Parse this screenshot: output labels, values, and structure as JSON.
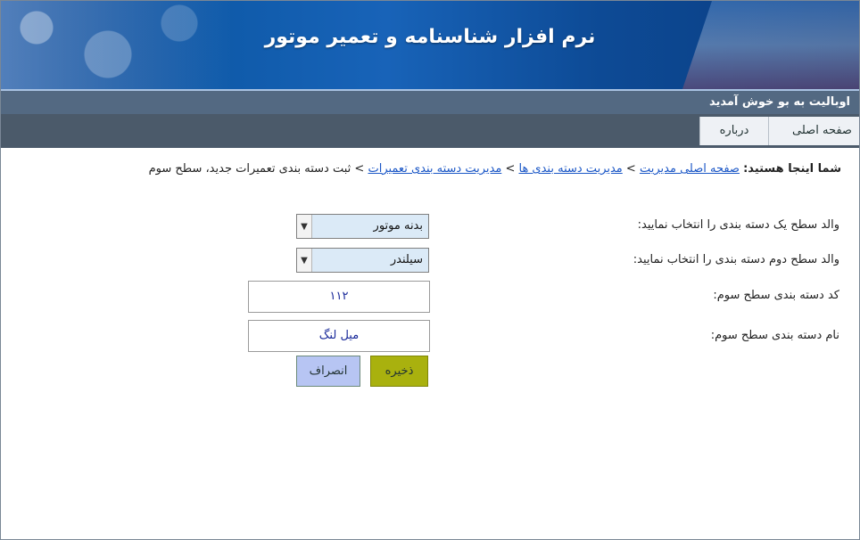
{
  "header": {
    "title": "نرم افزار شناسنامه و تعمیر موتور"
  },
  "welcome": {
    "text": "اوبالیت به بو خوش آمدید"
  },
  "menu": {
    "items": [
      "صفحه اصلی",
      "درباره"
    ]
  },
  "breadcrumb": {
    "lead": "شما اینجا هستید:",
    "links": [
      "صفحه اصلی مدیریت",
      "مدیریت دسته بندی ها",
      "مدیریت دسته بندی تعمیرات"
    ],
    "separator": ">",
    "current": "ثبت دسته بندی تعمیرات جدید، سطح سوم"
  },
  "form": {
    "level1_label": "والد سطح یک دسته بندی را انتخاب نمایید:",
    "level1_value": "بدنه موتور",
    "level2_label": "والد سطح دوم دسته بندی را انتخاب نمایید:",
    "level2_value": "سیلندر",
    "code_label": "کد دسته بندی سطح سوم:",
    "code_value": "۱۱۲",
    "name_label": "نام دسته بندی سطح سوم:",
    "name_value": "میل لنگ",
    "save_label": "ذخیره",
    "cancel_label": "انصراف"
  }
}
